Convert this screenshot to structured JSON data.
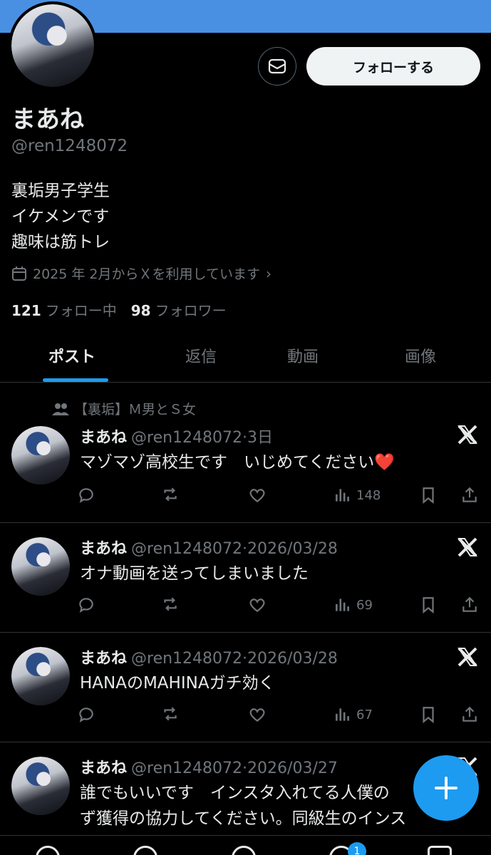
{
  "profile": {
    "display_name": "まあね",
    "handle": "@ren1248072",
    "bio_lines": [
      "裏垢男子学生",
      "イケメンです",
      "趣味は筋トレ"
    ],
    "joined": "2025 年 2月からＸを利用しています",
    "following_count": "121",
    "following_label": "フォロー中",
    "followers_count": "98",
    "followers_label": "フォロワー",
    "follow_label": "フォローする"
  },
  "tabs": [
    "ポスト",
    "返信",
    "動画",
    "画像"
  ],
  "community_label": "【裏垢】Ｍ男とＳ女",
  "posts": [
    {
      "name": "まあね",
      "handle": "@ren1248072",
      "time": "3日",
      "text": "マゾマゾ高校生です　いじめてください❤️",
      "views": "148"
    },
    {
      "name": "まあね",
      "handle": "@ren1248072",
      "time": "2026/03/28",
      "text": "オナ動画を送ってしまいました",
      "views": "69"
    },
    {
      "name": "まあね",
      "handle": "@ren1248072",
      "time": "2026/03/28",
      "text": "HANAのMAHINAガチ効く",
      "views": "67"
    },
    {
      "name": "まあね",
      "handle": "@ren1248072",
      "time": "2026/03/27",
      "text": "誰でもいいです　インスタ入れてる人僕の",
      "text2": "ず獲得の協力してください。同級生のインス"
    }
  ],
  "nav_badge": "1",
  "colors": {
    "accent": "#1d9bf0",
    "banner": "#4a90e2",
    "muted": "#71767b"
  }
}
